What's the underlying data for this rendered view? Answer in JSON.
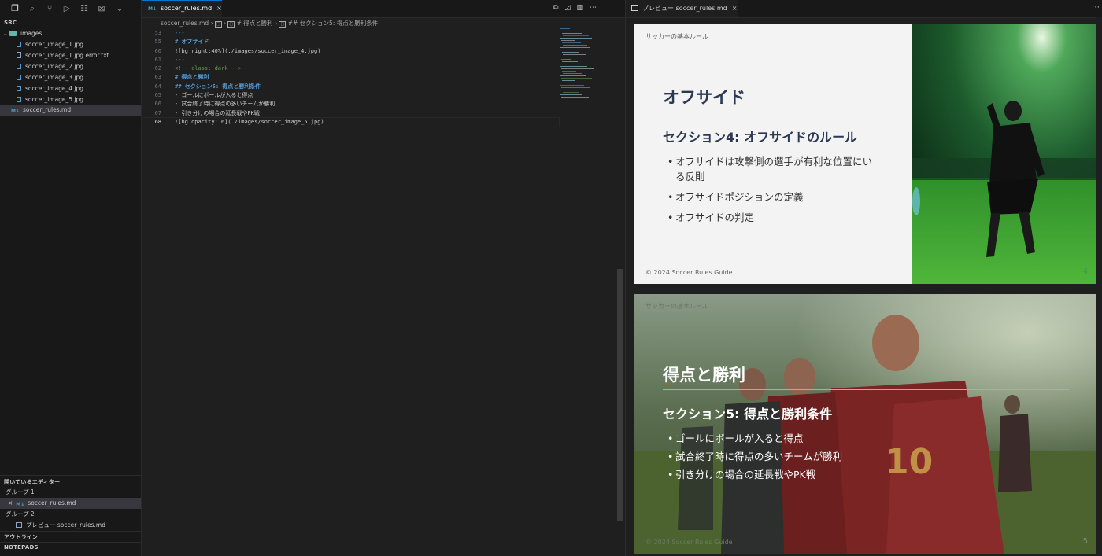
{
  "sidebar": {
    "section": "SRC",
    "folder": "images",
    "files": [
      "soccer_image_1.jpg",
      "soccer_image_1.jpg.error.txt",
      "soccer_image_2.jpg",
      "soccer_image_3.jpg",
      "soccer_image_4.jpg",
      "soccer_image_5.jpg"
    ],
    "md_file": "soccer_rules.md",
    "open_editors": {
      "title": "開いているエディター",
      "group1": "グループ 1",
      "group1_file": "soccer_rules.md",
      "group2": "グループ 2",
      "group2_file": "プレビュー soccer_rules.md"
    },
    "outline": "アウトライン",
    "notepads": "NOTEPADS"
  },
  "editor": {
    "tab": "soccer_rules.md",
    "breadcrumb": {
      "file": "soccer_rules.md",
      "h1": "# 得点と勝利",
      "h2": "## セクション5: 得点と勝利条件"
    },
    "lines": [
      {
        "n": "53",
        "text": "---",
        "cls": "t-sep"
      },
      {
        "n": "55",
        "text": "# オフサイド",
        "cls": "t-head"
      },
      {
        "n": "60",
        "text": "![bg right:40%](./images/soccer_image_4.jpg)",
        "cls": "t-plain"
      },
      {
        "n": "61",
        "text": "---",
        "cls": "t-sep"
      },
      {
        "n": "62",
        "text": "<!-- class: dark -->",
        "cls": "t-com"
      },
      {
        "n": "63",
        "text": "# 得点と勝利",
        "cls": "t-head"
      },
      {
        "n": "64",
        "text": "## セクション5: 得点と勝利条件",
        "cls": "t-head"
      },
      {
        "n": "65",
        "text": "- ゴールにボールが入ると得点",
        "cls": "t-plain"
      },
      {
        "n": "66",
        "text": "- 試合終了時に得点の多いチームが勝利",
        "cls": "t-plain"
      },
      {
        "n": "67",
        "text": "- 引き分けの場合の延長戦やPK戦",
        "cls": "t-plain"
      },
      {
        "n": "68",
        "text": "![bg opacity:.6](./images/soccer_image_5.jpg)",
        "cls": "t-plain"
      }
    ]
  },
  "preview": {
    "tab": "プレビュー soccer_rules.md",
    "slide4": {
      "header": "サッカーの基本ルール",
      "title": "オフサイド",
      "subtitle": "セクション4: オフサイドのルール",
      "bullets": [
        "オフサイドは攻撃側の選手が有利な位置にいる反則",
        "オフサイドポジションの定義",
        "オフサイドの判定"
      ],
      "footer": "© 2024 Soccer Rules Guide",
      "page": "4"
    },
    "slide5": {
      "header": "サッカーの基本ルール",
      "title": "得点と勝利",
      "subtitle": "セクション5: 得点と勝利条件",
      "bullets": [
        "ゴールにボールが入ると得点",
        "試合終了時に得点の多いチームが勝利",
        "引き分けの場合の延長戦やPK戦"
      ],
      "footer": "© 2024 Soccer Rules Guide",
      "page": "5"
    }
  },
  "colors": {
    "accent": "#0078d4",
    "gold_rule": "#c8a96e",
    "slide_text": "#2b3a52"
  }
}
